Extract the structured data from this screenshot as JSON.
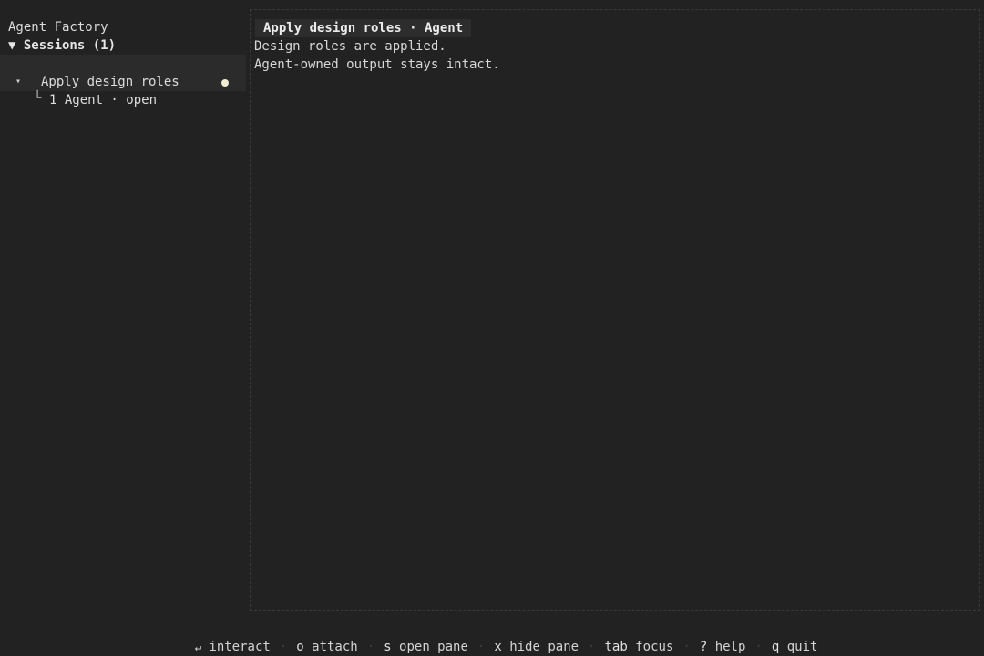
{
  "sidebar": {
    "app_title": "Agent Factory",
    "sessions_header": "▼ Sessions (1)",
    "sessions": [
      {
        "caret": "▾",
        "name": "Apply design roles",
        "status_color": "#f2eed2",
        "agent_branch": "└",
        "agent_label": "1 Agent · open"
      }
    ]
  },
  "pane": {
    "title": "Apply design roles · Agent",
    "lines": [
      "Design roles are applied.",
      "Agent-owned output stays intact."
    ]
  },
  "footer": {
    "separator": "·",
    "items": [
      {
        "key": "↵",
        "label": "interact"
      },
      {
        "key": "o",
        "label": "attach"
      },
      {
        "key": "s",
        "label": "open pane"
      },
      {
        "key": "x",
        "label": "hide pane"
      },
      {
        "key": "tab",
        "label": "focus"
      },
      {
        "key": "?",
        "label": "help"
      },
      {
        "key": "q",
        "label": "quit"
      }
    ]
  }
}
